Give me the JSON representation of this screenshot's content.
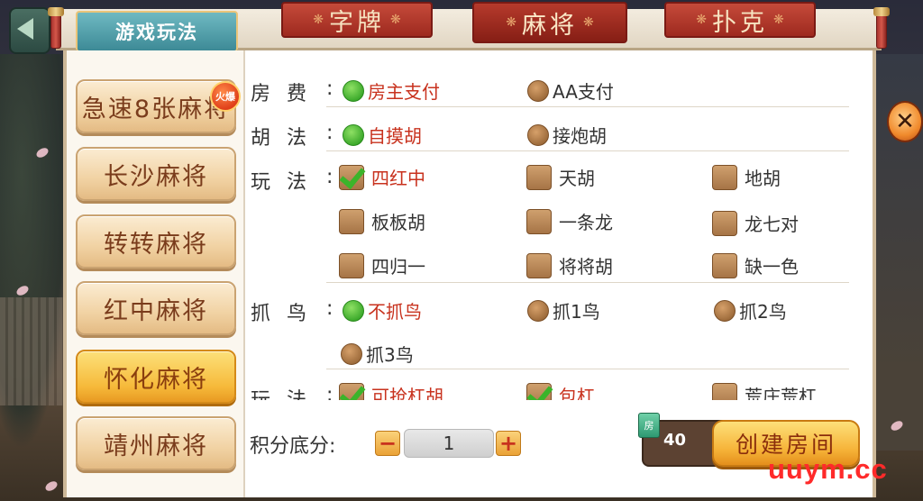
{
  "header": {
    "section_title": "游戏玩法",
    "tabs": [
      {
        "label": "字牌",
        "active": false
      },
      {
        "label": "麻将",
        "active": true
      },
      {
        "label": "扑克",
        "active": false
      }
    ]
  },
  "sidebar": {
    "items": [
      {
        "label": "急速8张麻将",
        "badge": "火爆",
        "active": false
      },
      {
        "label": "长沙麻将",
        "active": false
      },
      {
        "label": "转转麻将",
        "active": false
      },
      {
        "label": "红中麻将",
        "active": false
      },
      {
        "label": "怀化麻将",
        "active": true
      },
      {
        "label": "靖州麻将",
        "active": false
      }
    ]
  },
  "options": {
    "fee": {
      "label": "房费",
      "choices": [
        {
          "label": "房主支付",
          "selected": true
        },
        {
          "label": "AA支付",
          "selected": false
        }
      ]
    },
    "hu_method": {
      "label": "胡法",
      "choices": [
        {
          "label": "自摸胡",
          "selected": true
        },
        {
          "label": "接炮胡",
          "selected": false
        }
      ]
    },
    "play_rules": {
      "label": "玩法",
      "choices": [
        {
          "label": "四红中",
          "checked": true
        },
        {
          "label": "天胡",
          "checked": false
        },
        {
          "label": "地胡",
          "checked": false
        },
        {
          "label": "板板胡",
          "checked": false
        },
        {
          "label": "一条龙",
          "checked": false
        },
        {
          "label": "龙七对",
          "checked": false
        },
        {
          "label": "四归一",
          "checked": false
        },
        {
          "label": "将将胡",
          "checked": false
        },
        {
          "label": "缺一色",
          "checked": false
        }
      ]
    },
    "bird": {
      "label": "抓鸟",
      "choices": [
        {
          "label": "不抓鸟",
          "selected": true
        },
        {
          "label": "抓1鸟",
          "selected": false
        },
        {
          "label": "抓2鸟",
          "selected": false
        },
        {
          "label": "抓3鸟",
          "selected": false
        }
      ]
    },
    "play_rules_2": {
      "label": "玩法",
      "choices": [
        {
          "label": "可抢杠胡",
          "checked": true
        },
        {
          "label": "包杠",
          "checked": true
        },
        {
          "label": "荒庄荒杠",
          "checked": false
        }
      ]
    }
  },
  "footer": {
    "score_label": "积分底分:",
    "score_value": "1",
    "minus": "−",
    "plus": "+",
    "room_icon": "房",
    "cost": "40",
    "create_label": "创建房间"
  },
  "close_symbol": "✕",
  "watermark": "uuym.cc",
  "colors": {
    "tab_red": "#9e2a1f",
    "selected_text": "#c8321e",
    "radio_on": "#3aa82a",
    "button_gold": "#f6b338"
  }
}
